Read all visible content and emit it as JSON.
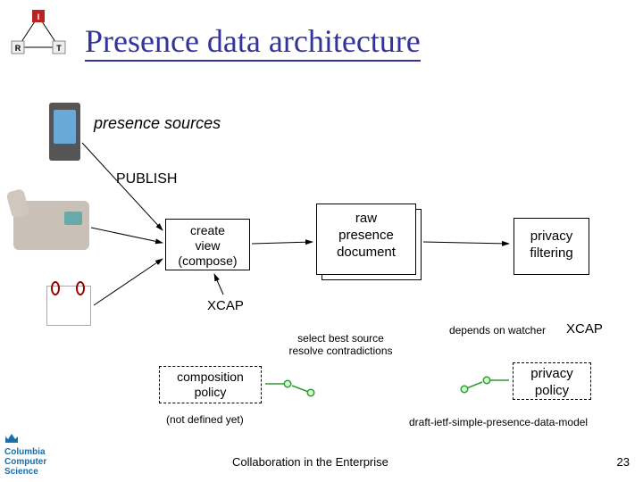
{
  "title": "Presence data architecture",
  "labels": {
    "presence_sources": "presence sources",
    "publish": "PUBLISH",
    "create_view": "create\nview\n(compose)",
    "raw_doc": "raw\npresence\ndocument",
    "privacy_filtering": "privacy\nfiltering",
    "xcap1": "XCAP",
    "xcap2": "XCAP",
    "cloud1": "select best source\nresolve contradictions",
    "cloud2": "depends on watcher",
    "composition_policy": "composition\npolicy",
    "privacy_policy": "privacy\npolicy",
    "not_defined": "(not defined yet)",
    "draft": "draft-ietf-simple-presence-data-model"
  },
  "footer": {
    "center": "Collaboration in the Enterprise",
    "page": "23",
    "affiliation": "Columbia\nComputer\nScience"
  },
  "logo_nodes": {
    "top": "I",
    "left": "R",
    "right": "T"
  }
}
